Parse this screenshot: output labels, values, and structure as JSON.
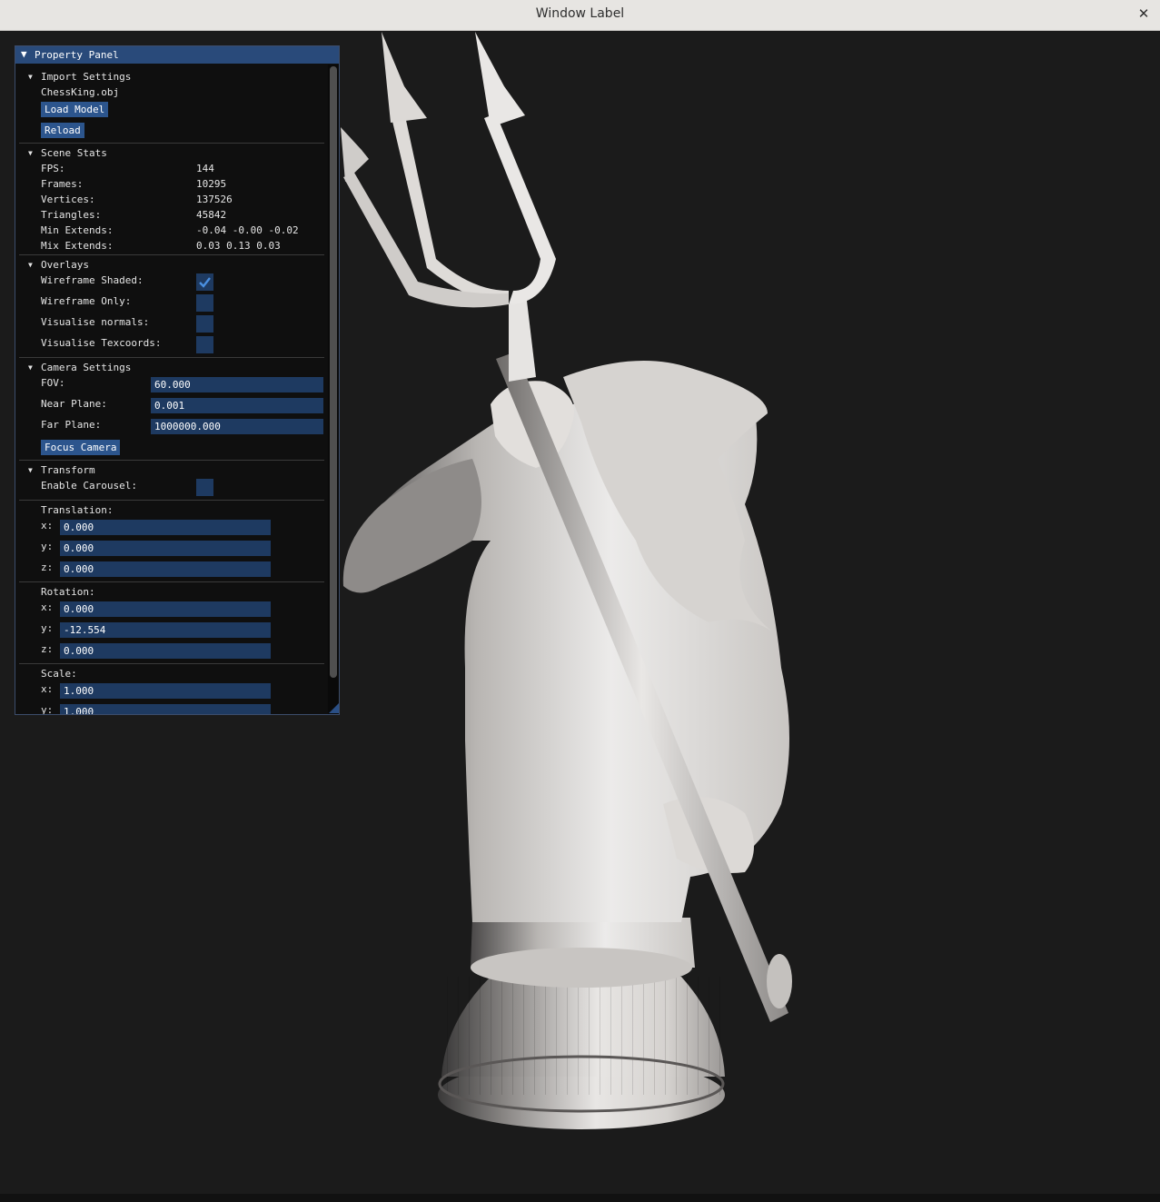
{
  "window": {
    "title": "Window Label",
    "close_glyph": "✕"
  },
  "colors": {
    "panel_header": "#294a7a",
    "button": "#2c558d",
    "field": "#1e3a61",
    "checkmark": "#4a8fe0",
    "viewport_bg": "#1b1b1b"
  },
  "panel": {
    "title": "Property Panel",
    "import": {
      "header": "Import Settings",
      "filename": "ChessKing.obj",
      "load_label": "Load Model",
      "reload_label": "Reload"
    },
    "stats": {
      "header": "Scene Stats",
      "rows": [
        {
          "label": "FPS:",
          "value": "144"
        },
        {
          "label": "Frames:",
          "value": "10295"
        },
        {
          "label": "Vertices:",
          "value": "137526"
        },
        {
          "label": "Triangles:",
          "value": "45842"
        },
        {
          "label": "Min Extends:",
          "value": "-0.04 -0.00 -0.02"
        },
        {
          "label": "Mix Extends:",
          "value": "0.03 0.13 0.03"
        }
      ]
    },
    "overlays": {
      "header": "Overlays",
      "items": [
        {
          "label": "Wireframe Shaded:",
          "checked": true
        },
        {
          "label": "Wireframe Only:",
          "checked": false
        },
        {
          "label": "Visualise normals:",
          "checked": false
        },
        {
          "label": "Visualise Texcoords:",
          "checked": false
        }
      ]
    },
    "camera": {
      "header": "Camera Settings",
      "fov_label": "FOV:",
      "fov_value": "60.000",
      "near_label": "Near Plane:",
      "near_value": "0.001",
      "far_label": "Far Plane:",
      "far_value": "1000000.000",
      "focus_label": "Focus Camera"
    },
    "transform": {
      "header": "Transform",
      "carousel_label": "Enable Carousel:",
      "carousel_checked": false,
      "translation": {
        "label": "Translation:",
        "x": "0.000",
        "y": "0.000",
        "z": "0.000"
      },
      "rotation": {
        "label": "Rotation:",
        "x": "0.000",
        "y": "-12.554",
        "z": "0.000"
      },
      "scale": {
        "label": "Scale:",
        "x": "1.000",
        "y": "1.000"
      },
      "axis_x": "x:",
      "axis_y": "y:",
      "axis_z": "z:"
    }
  }
}
